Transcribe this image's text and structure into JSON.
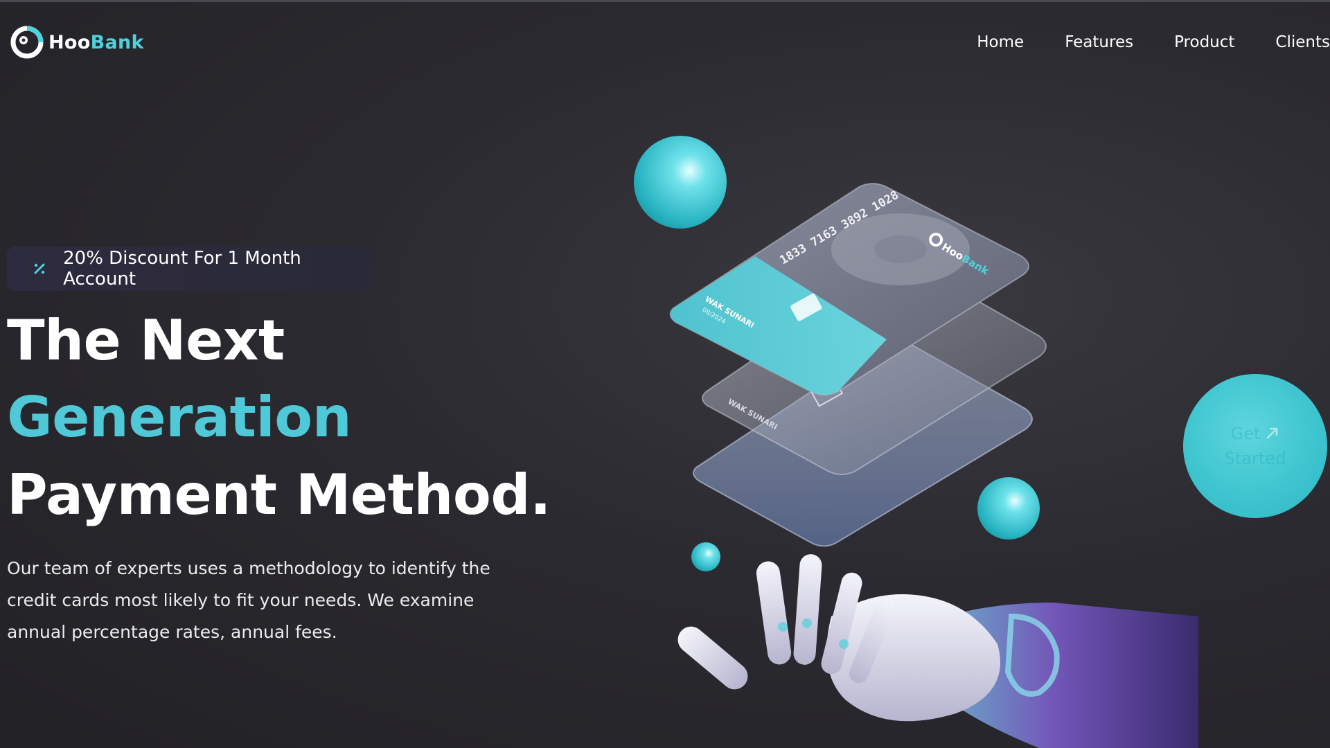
{
  "brand": {
    "name_part1": "Hoo",
    "name_part2": "Bank"
  },
  "nav": {
    "items": [
      "Home",
      "Features",
      "Product",
      "Clients"
    ]
  },
  "hero": {
    "discount_text": "20% Discount For 1 Month Account",
    "discount_icon": "percent-icon",
    "headline_line1": "The Next",
    "headline_line2": "Generation",
    "headline_line3": "Payment Method.",
    "description": "Our team of experts uses a methodology to identify the credit cards most likely to fit your needs. We examine annual percentage rates, annual fees."
  },
  "cta": {
    "line1": "Get",
    "line2": "Started",
    "icon": "arrow-up-right-icon"
  },
  "illustration": {
    "card_number": "1833 7163 3892 1028",
    "card_brand_part1": "Hoo",
    "card_brand_part2": "Bank",
    "card_holder": "WAK SUNARI",
    "card_expiry": "08/2024"
  },
  "colors": {
    "accent": "#4fd1dc",
    "background": "#2b2a30",
    "headline_accent": "#4fc9d8"
  }
}
